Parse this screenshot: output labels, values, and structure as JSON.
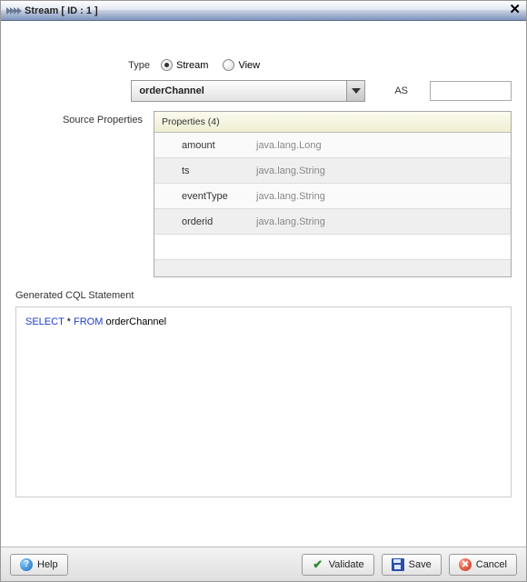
{
  "titlebar": {
    "title": "Stream [ ID : 1 ]"
  },
  "form": {
    "type_label": "Type",
    "radio_stream": "Stream",
    "radio_view": "View",
    "source_select": "orderChannel",
    "as_label": "AS",
    "as_value": "",
    "source_props_label": "Source Properties",
    "grid_header": "Properties (4)"
  },
  "props": [
    {
      "name": "amount",
      "type": "java.lang.Long"
    },
    {
      "name": "ts",
      "type": "java.lang.String"
    },
    {
      "name": "eventType",
      "type": "java.lang.String"
    },
    {
      "name": "orderid",
      "type": "java.lang.String"
    }
  ],
  "cql": {
    "section_label": "Generated CQL Statement",
    "kw_select": "SELECT",
    "star": " * ",
    "kw_from": "FROM",
    "tail": " orderChannel"
  },
  "footer": {
    "help": "Help",
    "validate": "Validate",
    "save": "Save",
    "cancel": "Cancel"
  }
}
